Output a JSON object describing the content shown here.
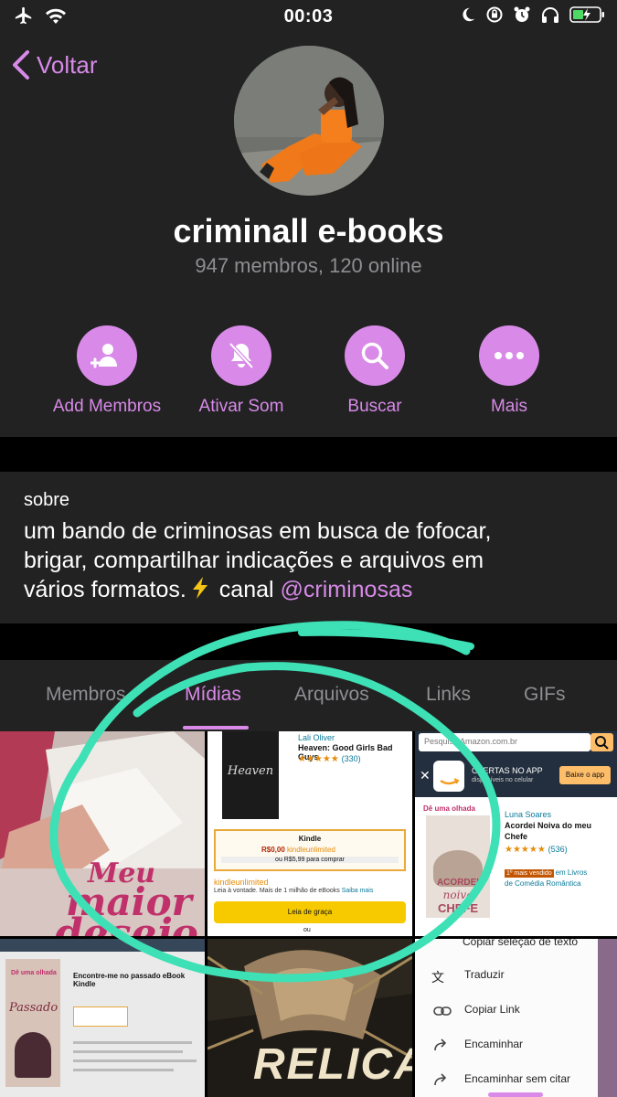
{
  "status_bar": {
    "time": "00:03"
  },
  "nav": {
    "back_label": "Voltar"
  },
  "profile": {
    "name": "criminall e-books",
    "subtitle": "947 membros, 120 online"
  },
  "actions": [
    {
      "label": "Add Membros",
      "icon": "add-member-icon"
    },
    {
      "label": "Ativar Som",
      "icon": "bell-muted-icon"
    },
    {
      "label": "Buscar",
      "icon": "search-icon"
    },
    {
      "label": "Mais",
      "icon": "more-icon"
    }
  ],
  "about": {
    "heading": "sobre",
    "text_line1": "um bando de criminosas em busca de fofocar,",
    "text_line2": "brigar, compartilhar indicações e arquivos em",
    "text_line3_prefix": "vários formatos.",
    "text_line3_middle": " canal ",
    "channel_link": "@criminosas"
  },
  "tabs": [
    {
      "label": "Membros",
      "active": false
    },
    {
      "label": "Mídias",
      "active": true
    },
    {
      "label": "Arquivos",
      "active": false
    },
    {
      "label": "Links",
      "active": false
    },
    {
      "label": "GIFs",
      "active": false
    }
  ],
  "media": {
    "cover1_text1": "Meu",
    "cover1_text2": "maior",
    "cover1_text3": "desejo",
    "amazon1": {
      "author": "Lali Oliver",
      "title": "Heaven: Good Girls Bad Guys",
      "rating_count": "(330)",
      "cover_title": "Heaven",
      "format": "Kindle",
      "price": "R$0,00",
      "price_suffix": "kindleunlimited",
      "alt_price": "ou R$5,99 para comprar",
      "ku_title": "kindleunlimited",
      "ku_desc": "Leia à vontade. Mais de 1 milhão de eBooks",
      "ku_more": "Saiba mais",
      "read_btn": "Leia de graça",
      "or": "ou"
    },
    "amazon2": {
      "search_placeholder": "Pesquisa Amazon.com.br",
      "app_banner_title": "OFERTAS NO APP",
      "app_banner_sub": "disponíveis no celular",
      "app_btn": "Baixe o app",
      "author": "Luna Soares",
      "title_line1": "Acordei Noiva do meu",
      "title_line2": "Chefe",
      "rating_count": "(536)",
      "badge": "1º mais vendido",
      "category_prefix": "em Livros",
      "category": "de Comédia Romântica",
      "cover_text1": "ACORDEI",
      "cover_text2": "noiva",
      "cover_text3": "CHEFE",
      "cover_brand": "Dê uma olhada"
    },
    "amazon3": {
      "brand": "Dê uma olhada",
      "title": "Encontre-me no passado eBook Kindle",
      "cover_text": "Passado"
    },
    "cover4_text": "RELICAR",
    "menu": {
      "items": [
        "Copiar seleção de texto",
        "Traduzir",
        "Copiar Link",
        "Encaminhar",
        "Encaminhar sem citar"
      ]
    }
  },
  "colors": {
    "accent": "#d98ae8",
    "panel": "#222222",
    "background": "#000000",
    "secondary_text": "#8e8e93",
    "highlight_annotation": "#3ee0b5"
  }
}
